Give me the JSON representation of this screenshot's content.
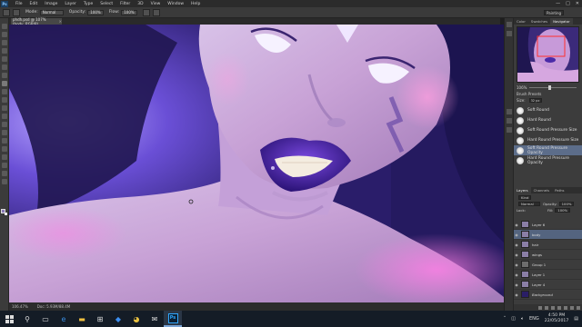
{
  "app": {
    "menu": [
      "File",
      "Edit",
      "Image",
      "Layer",
      "Type",
      "Select",
      "Filter",
      "3D",
      "View",
      "Window",
      "Help"
    ],
    "window_controls": [
      "—",
      "□",
      "✕"
    ]
  },
  "options_bar": {
    "mode_label": "Mode:",
    "mode_value": "Normal",
    "opacity_label": "Opacity:",
    "opacity_value": "100%",
    "flow_label": "Flow:",
    "flow_value": "100%",
    "workspace": "Painting"
  },
  "document": {
    "tab_title": "phdh.psd @ 107% (body, RGB/8)",
    "close": "×"
  },
  "status": {
    "zoom": "106.47%",
    "doc": "Doc: 5.93M/88.4M"
  },
  "navigator": {
    "tabs": [
      "Color",
      "Swatches",
      "Navigator"
    ],
    "active_tab": "Navigator",
    "zoom_value": "106%"
  },
  "brush_presets": {
    "header": "Brush Presets",
    "size_label": "Size:",
    "size_value": "32 px",
    "items": [
      {
        "label": "Soft Round",
        "selected": false
      },
      {
        "label": "Hard Round",
        "selected": false
      },
      {
        "label": "Soft Round Pressure Size",
        "selected": false
      },
      {
        "label": "Hard Round Pressure Size",
        "selected": false
      },
      {
        "label": "Soft Round Pressure Opacity",
        "selected": true
      },
      {
        "label": "Hard Round Pressure Opacity",
        "selected": false
      }
    ]
  },
  "layers_panel": {
    "tabs": [
      "Layers",
      "Channels",
      "Paths"
    ],
    "active_tab": "Layers",
    "kind_label": "Kind",
    "blend_mode": "Normal",
    "opacity_label": "Opacity:",
    "opacity_value": "100%",
    "lock_label": "Lock:",
    "fill_label": "Fill:",
    "fill_value": "100%",
    "layers": [
      {
        "name": "Layer 6",
        "type": "layer",
        "selected": false
      },
      {
        "name": "body",
        "type": "layer",
        "selected": true
      },
      {
        "name": "hair",
        "type": "layer",
        "selected": false
      },
      {
        "name": "wings",
        "type": "layer",
        "selected": false
      },
      {
        "name": "Group 1",
        "type": "folder",
        "selected": false
      },
      {
        "name": "Layer 1",
        "type": "layer",
        "selected": false
      },
      {
        "name": "Layer 4",
        "type": "layer",
        "selected": false
      },
      {
        "name": "Background",
        "type": "background",
        "selected": false
      }
    ]
  },
  "taskbar": {
    "lang": "ENG",
    "time": "4:50 PM",
    "date": "22/05/2017"
  }
}
